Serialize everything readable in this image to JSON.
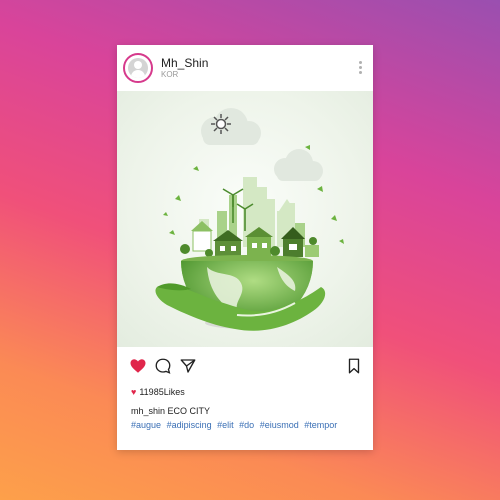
{
  "post": {
    "username": "Mh_Shin",
    "location": "KOR",
    "likes_label": "11985Likes",
    "caption_user": "mh_shin",
    "caption_text": "ECO CITY",
    "hashtags": [
      "#augue",
      "#adipiscing",
      "#elit",
      "#do",
      "#eiusmod",
      "#tempor"
    ]
  },
  "icons": {
    "avatar": "user-avatar-icon",
    "more": "more-vertical-icon",
    "like": "heart-icon",
    "comment": "comment-icon",
    "share": "send-icon",
    "save": "bookmark-icon"
  },
  "colors": {
    "like_active": "#e0264b",
    "hashtag": "#3a6fb5",
    "avatar_ring": "#d63a8c",
    "illustration_green": "#6cb33f"
  }
}
